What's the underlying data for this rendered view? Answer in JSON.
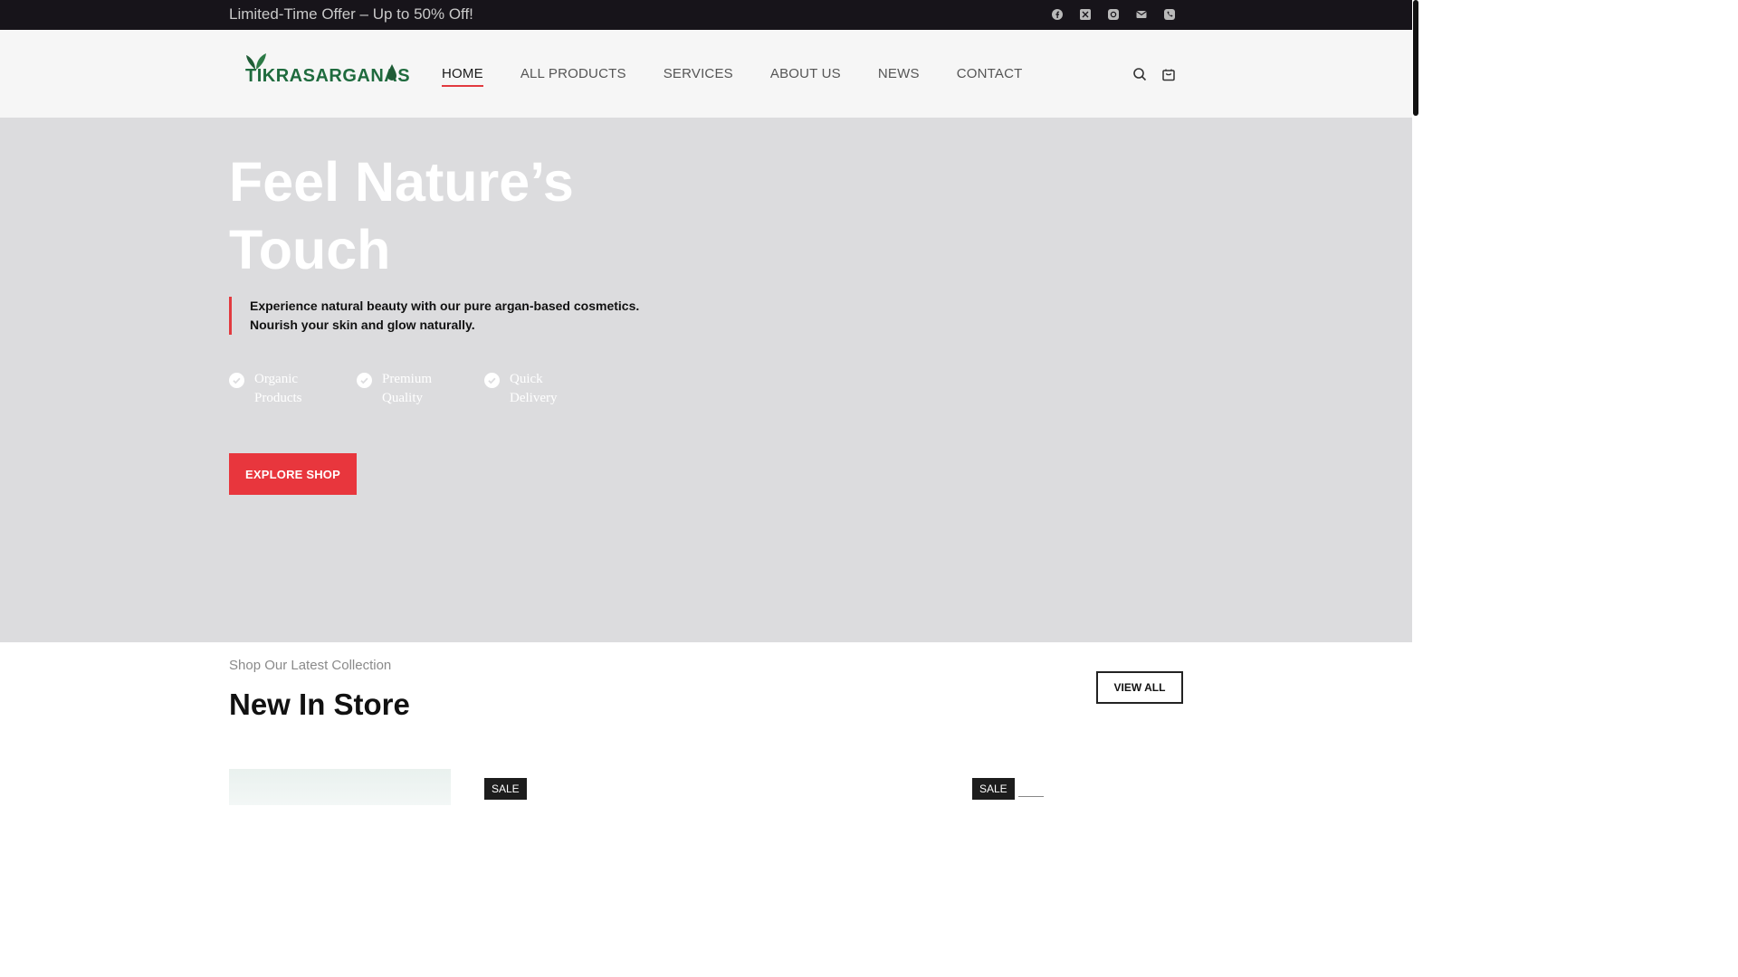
{
  "topbar": {
    "offer": "Limited-Time Offer – Up to 50% Off!",
    "socials": [
      "facebook-icon",
      "x-twitter-icon",
      "instagram-icon",
      "email-icon",
      "phone-icon"
    ]
  },
  "header": {
    "logo_text": "TIKRASARGANAS",
    "nav": [
      "HOME",
      "ALL PRODUCTS",
      "SERVICES",
      "ABOUT US",
      "NEWS",
      "CONTACT"
    ],
    "active_nav": "HOME"
  },
  "hero": {
    "title": "Feel Nature’s Touch",
    "description": "Experience natural beauty with our pure argan-based cosmetics. Nourish your skin and glow naturally.",
    "features": [
      "Organic Products",
      "Premium Quality",
      "Quick Delivery"
    ],
    "cta": "EXPLORE SHOP"
  },
  "collection": {
    "subheading": "Shop Our Latest Collection",
    "heading": "New In Store",
    "view_all": "VIEW ALL",
    "sale_badge_1": "SALE",
    "sale_badge_2": "SALE"
  },
  "colors": {
    "accent": "#e8363d",
    "brand_green": "#1f6b3e",
    "topbar_bg": "#17141a",
    "hero_bg": "#dcdcde"
  }
}
